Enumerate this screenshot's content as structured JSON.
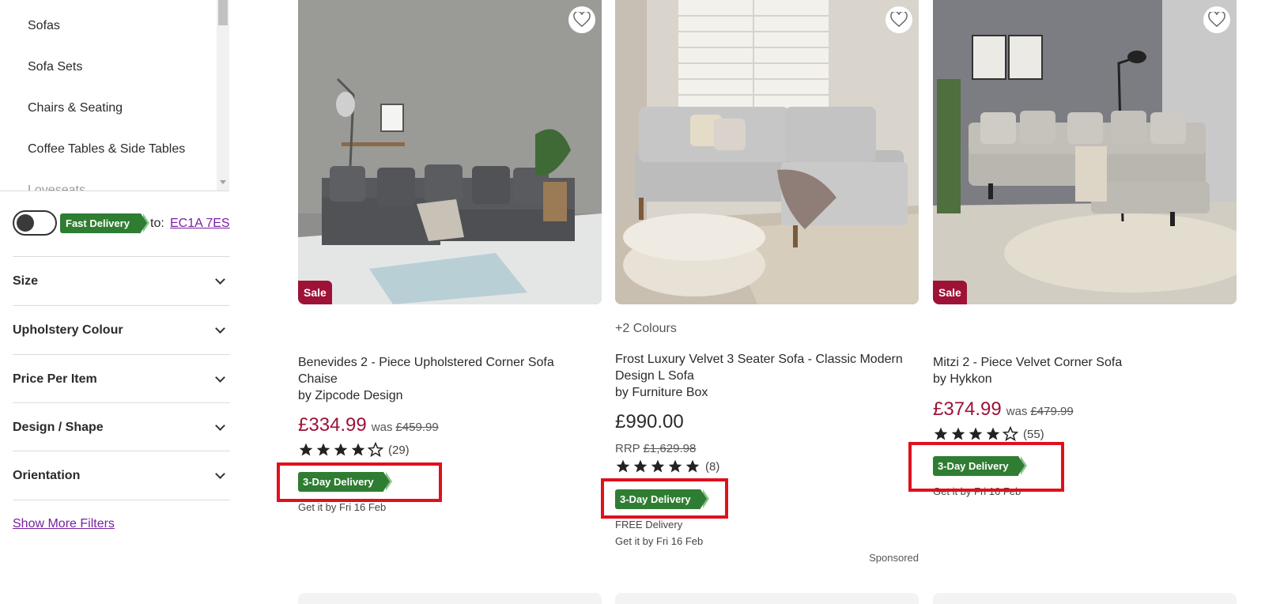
{
  "sidebar": {
    "categories": [
      "Sofas",
      "Sofa Sets",
      "Chairs & Seating",
      "Coffee Tables & Side Tables",
      "Loveseats"
    ],
    "fast_delivery_label": "Fast Delivery",
    "to_label": "to:",
    "postcode": "EC1A 7ES",
    "filters": [
      "Size",
      "Upholstery Colour",
      "Price Per Item",
      "Design / Shape",
      "Orientation"
    ],
    "show_more": "Show More Filters"
  },
  "products": [
    {
      "sale_badge": "Sale",
      "title": "Benevides 2 - Piece Upholstered Corner Sofa Chaise",
      "brand": "by Zipcode Design",
      "price": "£334.99",
      "was_label": "was",
      "was_price": "£459.99",
      "rating": 4,
      "review_count": "(29)",
      "delivery_badge": "3-Day Delivery",
      "get_it_by": "Get it by Fri 16 Feb"
    },
    {
      "colours": "+2 Colours",
      "title": "Frost Luxury Velvet 3 Seater Sofa - Classic Modern Design L Sofa",
      "brand": "by Furniture Box",
      "price": "£990.00",
      "rrp_label": "RRP",
      "rrp_price": "£1,629.98",
      "rating": 5,
      "review_count": "(8)",
      "delivery_badge": "3-Day Delivery",
      "free_delivery": "FREE Delivery",
      "get_it_by": "Get it by Fri 16 Feb",
      "sponsored": "Sponsored"
    },
    {
      "sale_badge": "Sale",
      "title": "Mitzi 2 - Piece Velvet Corner Sofa",
      "brand": "by Hykkon",
      "price": "£374.99",
      "was_label": "was",
      "was_price": "£479.99",
      "rating": 4,
      "review_count": "(55)",
      "delivery_badge": "3-Day Delivery",
      "get_it_by": "Get it by Fri 16 Feb"
    }
  ],
  "colors": {
    "sale": "#9e1237",
    "delivery": "#2f7d32",
    "highlight": "#e0101c",
    "link": "#7a1fa2"
  }
}
